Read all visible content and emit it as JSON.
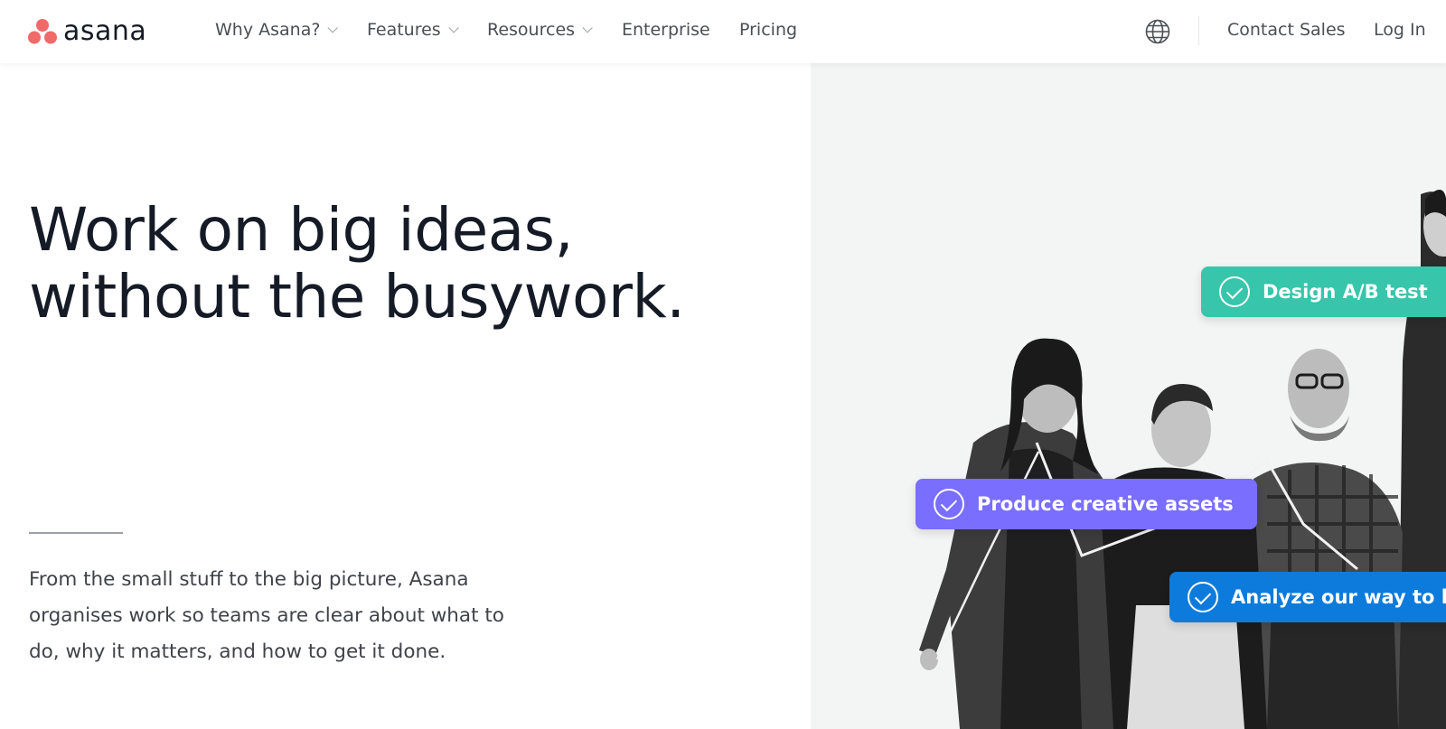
{
  "brand": {
    "name": "asana",
    "color": "#f06a6a"
  },
  "nav": {
    "items": [
      {
        "label": "Why Asana?",
        "dropdown": true
      },
      {
        "label": "Features",
        "dropdown": true
      },
      {
        "label": "Resources",
        "dropdown": true
      },
      {
        "label": "Enterprise",
        "dropdown": false
      },
      {
        "label": "Pricing",
        "dropdown": false
      }
    ],
    "language_icon": "globe-icon",
    "contact_sales": "Contact Sales",
    "log_in": "Log In"
  },
  "hero": {
    "title_line1": "Work on big ideas,",
    "title_line2": "without the busywork.",
    "description": "From the small stuff to the big picture, Asana organises work so teams are clear about what to do, why it matters, and how to get it done."
  },
  "image_tags": [
    {
      "label": "Design A/B test",
      "color": "#37c5ab",
      "icon": "check-circle-icon"
    },
    {
      "label": "Produce creative assets",
      "color": "#796eff",
      "icon": "check-circle-icon"
    },
    {
      "label": "Analyze our way to hap",
      "color": "#0d7bdb",
      "icon": "check-circle-icon"
    }
  ]
}
